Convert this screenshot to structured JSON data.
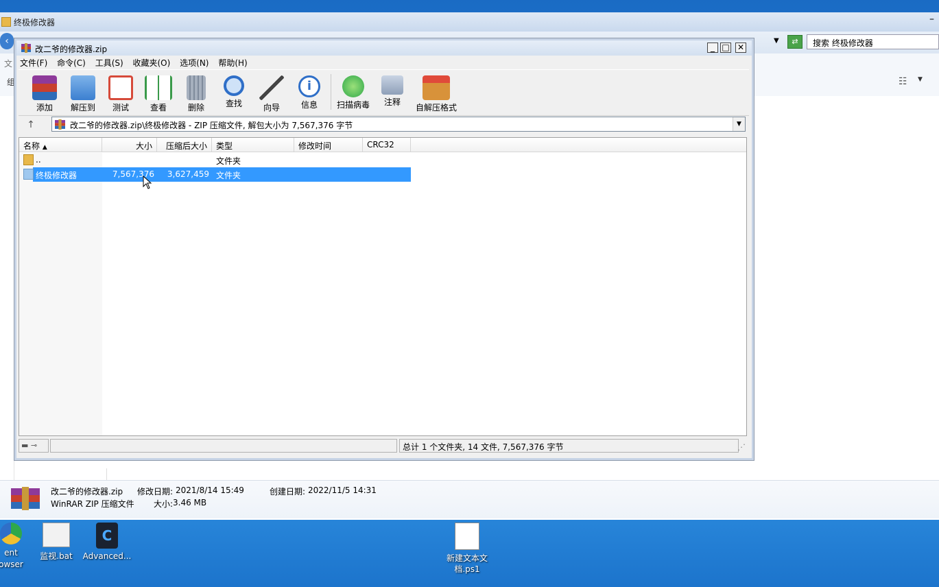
{
  "explorer": {
    "title": "终极修改器",
    "search_placeholder": "搜索 终极修改器",
    "left_glyphs": [
      "文",
      "组"
    ]
  },
  "details": {
    "name": "改二爷的修改器.zip",
    "type": "WinRAR ZIP 压缩文件",
    "modified_label": "修改日期:",
    "modified_value": "2021/8/14 15:49",
    "size_label": "大小:",
    "size_value": "3.46 MB",
    "created_label": "创建日期:",
    "created_value": "2022/11/5 14:31"
  },
  "rar": {
    "title": "改二爷的修改器.zip",
    "menu": [
      "文件(F)",
      "命令(C)",
      "工具(S)",
      "收藏夹(O)",
      "选项(N)",
      "帮助(H)"
    ],
    "toolbar": [
      {
        "label": "添加",
        "icon": "add-archive-icon",
        "color": "#c0392b"
      },
      {
        "label": "解压到",
        "icon": "extract-to-icon",
        "color": "#3b7fd0"
      },
      {
        "label": "测试",
        "icon": "test-icon",
        "color": "#d64a3a"
      },
      {
        "label": "查看",
        "icon": "view-book-icon",
        "color": "#3a9a4a"
      },
      {
        "label": "删除",
        "icon": "trash-icon",
        "color": "#8a96a6"
      },
      {
        "label": "查找",
        "icon": "find-magnifier-icon",
        "color": "#2f6fc8"
      },
      {
        "label": "向导",
        "icon": "wizard-wand-icon",
        "color": "#e0a030"
      },
      {
        "label": "信息",
        "icon": "info-icon",
        "color": "#2f6fc8"
      },
      {
        "label": "扫描病毒",
        "icon": "virus-scan-icon",
        "color": "#2fa84a"
      },
      {
        "label": "注释",
        "icon": "comment-icon",
        "color": "#6c7f99"
      },
      {
        "label": "自解压格式",
        "icon": "sfx-box-icon",
        "color": "#d8923a"
      }
    ],
    "path": "改二爷的修改器.zip\\终极修改器 - ZIP 压缩文件, 解包大小为 7,567,376 字节",
    "columns": [
      "名称",
      "大小",
      "压缩后大小",
      "类型",
      "修改时间",
      "CRC32"
    ],
    "rows": [
      {
        "name": "..",
        "size": "",
        "packed": "",
        "type": "文件夹"
      },
      {
        "name": "终极修改器",
        "size": "7,567,376",
        "packed": "3,627,459",
        "type": "文件夹"
      }
    ],
    "status": "总计 1 个文件夹, 14 文件, 7,567,376 字节"
  },
  "desktop": [
    {
      "label": "ent\nowser",
      "icon": "browser-icon"
    },
    {
      "label": "监视.bat",
      "icon": "bat-file-icon"
    },
    {
      "label": "Advanced...",
      "icon": "advanced-app-icon"
    },
    {
      "label": "新建文本文\n档.ps1",
      "icon": "ps1-file-icon"
    }
  ]
}
